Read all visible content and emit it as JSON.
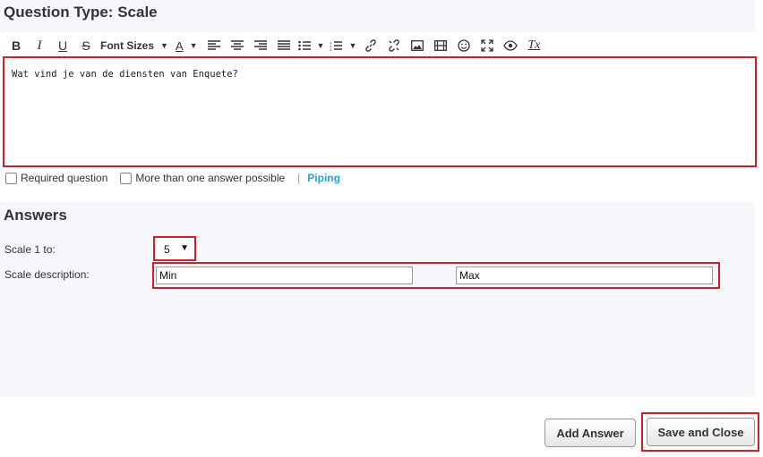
{
  "header": {
    "title": "Question Type: Scale"
  },
  "toolbar": {
    "font_sizes_label": "Font Sizes",
    "buttons": [
      {
        "name": "bold",
        "glyph": "B"
      },
      {
        "name": "italic",
        "glyph": "I"
      },
      {
        "name": "underline",
        "glyph": "U"
      },
      {
        "name": "strikethrough",
        "glyph": "S"
      }
    ],
    "text_color_glyph": "A",
    "clear_format_glyph": "Tx"
  },
  "editor": {
    "content": "Wat vind je van de diensten van Enquete?"
  },
  "options": {
    "required_label": "Required question",
    "multiple_label": "More than one answer possible",
    "separator": "|",
    "piping_label": "Piping"
  },
  "answers": {
    "title": "Answers",
    "scale_label": "Scale 1 to:",
    "scale_value": "5",
    "description_label": "Scale description:",
    "min_value": "Min",
    "max_value": "Max"
  },
  "buttons": {
    "add_answer": "Add Answer",
    "save_close": "Save and Close"
  },
  "colors": {
    "highlight": "#d02026",
    "link": "#2a9fd6",
    "panel_bg": "#f7f7fb"
  }
}
